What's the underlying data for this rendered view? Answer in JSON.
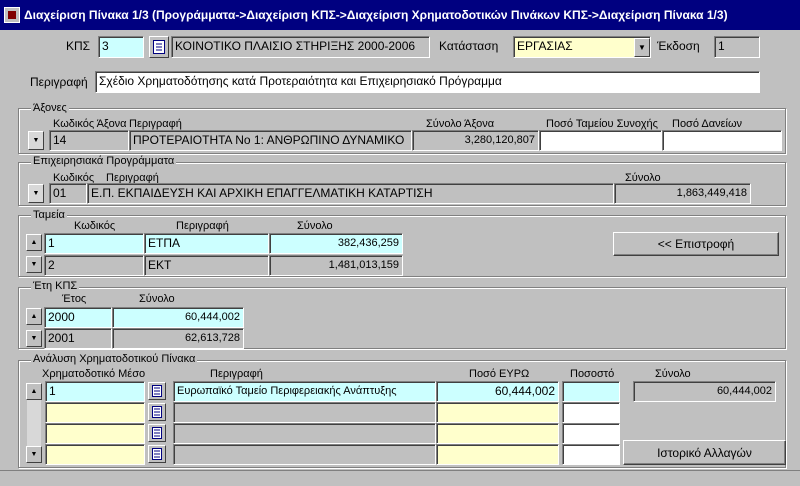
{
  "window": {
    "title": "Διαχείριση Πίνακα 1/3 (Προγράμματα->Διαχείριση ΚΠΣ->Διαχείριση Χρηματοδοτικών Πινάκων ΚΠΣ->Διαχείριση Πίνακα 1/3)"
  },
  "header": {
    "kps_label": "ΚΠΣ",
    "kps_value": "3",
    "kps_name": "ΚΟΙΝΟΤΙΚΟ ΠΛΑΙΣΙΟ ΣΤΗΡΙΞΗΣ 2000-2006",
    "status_label": "Κατάσταση",
    "status_value": "ΕΡΓΑΣΙΑΣ",
    "version_label": "Έκδοση",
    "version_value": "1",
    "description_label": "Περιγραφή",
    "description_value": "Σχέδιο Χρηματοδότησης κατά Προτεραιότητα και Επιχειρησιακό Πρόγραμμα"
  },
  "axes": {
    "title": "Άξονες",
    "col_code": "Κωδικός Άξονα",
    "col_description": "Περιγραφή",
    "col_total": "Σύνολο Άξονα",
    "col_cohesion": "Ποσό Ταμείου Συνοχής",
    "col_loans": "Ποσό Δανείων",
    "row": {
      "code": "14",
      "description": "ΠΡΟΤΕΡΑΙΟΤΗΤΑ Νο 1: ΑΝΘΡΩΠΙΝΟ ΔΥΝΑΜΙΚΟ",
      "total": "3,280,120,807",
      "cohesion": "",
      "loans": ""
    }
  },
  "programs": {
    "title": "Επιχειρησιακά Προγράμματα",
    "col_code": "Κωδικός",
    "col_description": "Περιγραφή",
    "col_total": "Σύνολο",
    "row": {
      "code": "01",
      "description": "Ε.Π. ΕΚΠΑΙΔΕΥΣΗ ΚΑΙ ΑΡΧΙΚΗ ΕΠΑΓΓΕΛΜΑΤΙΚΗ ΚΑΤΑΡΤΙΣΗ",
      "total": "1,863,449,418"
    }
  },
  "funds": {
    "title": "Ταμεία",
    "col_code": "Κωδικός",
    "col_description": "Περιγραφή",
    "col_total": "Σύνολο",
    "rows": [
      {
        "code": "1",
        "description": "ΕΤΠΑ",
        "total": "382,436,259"
      },
      {
        "code": "2",
        "description": "ΕΚΤ",
        "total": "1,481,013,159"
      }
    ],
    "return_button": "<< Επιστροφή"
  },
  "years": {
    "title": "Έτη ΚΠΣ",
    "col_year": "Έτος",
    "col_total": "Σύνολο",
    "rows": [
      {
        "year": "2000",
        "total": "60,444,002"
      },
      {
        "year": "2001",
        "total": "62,613,728"
      }
    ]
  },
  "analysis": {
    "title": "Ανάλυση Χρηματοδοτικού Πίνακα",
    "col_instrument": "Χρηματοδοτικό Μέσο",
    "col_description": "Περιγραφή",
    "col_amount": "Ποσό ΕΥΡΩ",
    "col_percent": "Ποσοστό",
    "col_total": "Σύνολο",
    "total_value": "60,444,002",
    "rows": [
      {
        "instrument": "1",
        "description": "Ευρωπαϊκό Ταμείο Περιφερειακής Ανάπτυξης",
        "amount": "60,444,002",
        "percent": ""
      },
      {
        "instrument": "",
        "description": "",
        "amount": "",
        "percent": ""
      },
      {
        "instrument": "",
        "description": "",
        "amount": "",
        "percent": ""
      },
      {
        "instrument": "",
        "description": "",
        "amount": "",
        "percent": ""
      }
    ],
    "history_button": "Ιστορικό Αλλαγών"
  }
}
